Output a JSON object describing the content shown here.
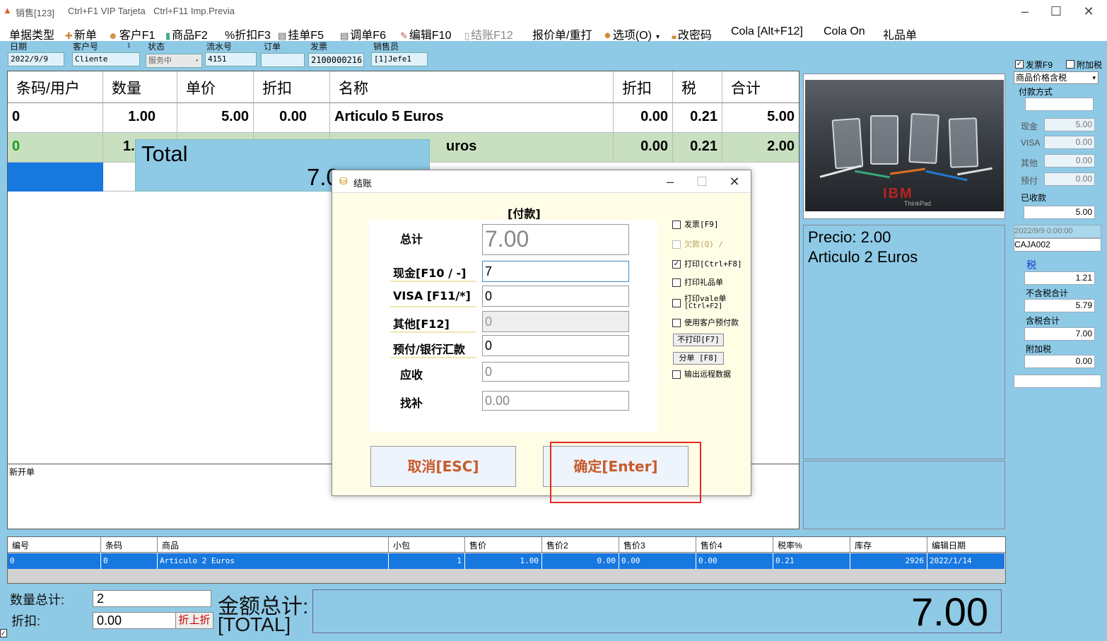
{
  "titlebar": {
    "title": "销售[123]",
    "hint1": "Ctrl+F1 VIP Tarjeta",
    "hint2": "Ctrl+F11 Imp.Previa"
  },
  "menu": [
    "单据类型",
    "新单",
    "客户F1",
    "商品F2",
    "%折扣F3",
    "挂单F5",
    "调单F6",
    "编辑F10",
    "结账F12",
    "报价单/重打",
    "选项(O)",
    "改密码",
    "Cola [Alt+F12]",
    "Cola On",
    "礼品单"
  ],
  "filters": {
    "date_label": "日期",
    "date_value": "2022/9/9",
    "client_label": "客户号",
    "client_value": "Cliente",
    "client_badge": "1",
    "status_label": "状态",
    "status_value": "服务中",
    "serial_label": "流水号",
    "serial_value": "4151",
    "order_label": "订单",
    "order_value": "",
    "invoice_label": "发票",
    "invoice_value": "2100000216",
    "seller_label": "销售员",
    "seller_value": "[1]Jefe1"
  },
  "grid": {
    "headers": [
      "条码/用户",
      "数量",
      "单价",
      "折扣",
      "名称",
      "折扣",
      "税",
      "合计"
    ],
    "rows": [
      [
        "0",
        "1.00",
        "5.00",
        "0.00",
        "Articulo 5 Euros",
        "0.00",
        "0.21",
        "5.00"
      ],
      [
        "0",
        "1.",
        "",
        "",
        "uros",
        "0.00",
        "0.21",
        "2.00"
      ]
    ]
  },
  "total_popup": {
    "label": "Total",
    "value": "7.0"
  },
  "notes_label": "新开单",
  "info": {
    "price": "Precio: 2.00",
    "name": "Articulo 2 Euros"
  },
  "right_panel": {
    "invoice_chk": "发票F9",
    "extra_tax_chk": "附加税",
    "price_mode": "商品价格含税",
    "pay_method": "付款方式",
    "cash_label": "现金",
    "cash": "5.00",
    "visa_label": "VISA",
    "visa": "0.00",
    "other_label": "其他",
    "other": "0.00",
    "prepay_label": "预付",
    "prepay": "0.00",
    "received_label": "已收款",
    "received": "5.00",
    "datetime": "2022/9/9 0:00:00",
    "register": "CAJA002",
    "tax_label": "税",
    "tax": "1.21",
    "net_label": "不含税合计",
    "net": "5.79",
    "gross_label": "含税合计",
    "gross": "7.00",
    "surcharge_label": "附加税",
    "surcharge": "0.00"
  },
  "lower": {
    "headers": [
      "编号",
      "条码",
      "商品",
      "小包",
      "售价",
      "售价2",
      "售价3",
      "售价4",
      "税率%",
      "库存",
      "编辑日期"
    ],
    "row": [
      "0",
      "0",
      "Articulo 2 Euros",
      "1",
      "1.00",
      "0.00",
      "0.00",
      "0.00",
      "0.21",
      "2926",
      "2022/1/14"
    ]
  },
  "footer": {
    "qty_label": "数量总计:",
    "qty": "2",
    "disc_label": "折扣:",
    "disc": "0.00",
    "disc_btn": "折上折",
    "amount_label": "金额总计:",
    "amount_sub": "[TOTAL]",
    "grand_total": "7.00"
  },
  "dialog": {
    "title": "结账",
    "header": "[付款]",
    "total_label": "总计",
    "total": "7.00",
    "cash_label": "现金[F10 / -]",
    "cash": "7",
    "visa_label": "VISA [F11/*]",
    "visa": "0",
    "other_label": "其他[F12]",
    "other": "0",
    "prepay_label": "预付/银行汇款",
    "prepay": "0",
    "due_label": "应收",
    "due": "0",
    "change_label": "找补",
    "change": "0.00",
    "opt_invoice": "发票[F9]",
    "opt_debt": "欠款(Q) /",
    "opt_print": "打印[Ctrl+F8]",
    "opt_gift": "打印礼品单",
    "opt_vale": "打印vale单",
    "opt_vale2": "[Ctrl+F2]",
    "opt_prepay": "使用客户预付款",
    "btn_noprint": "不打印[F7]",
    "btn_split": "分单 [F8]",
    "opt_remote": "输出远程数据",
    "cancel": "取消[ESC]",
    "ok": "确定[Enter]"
  }
}
